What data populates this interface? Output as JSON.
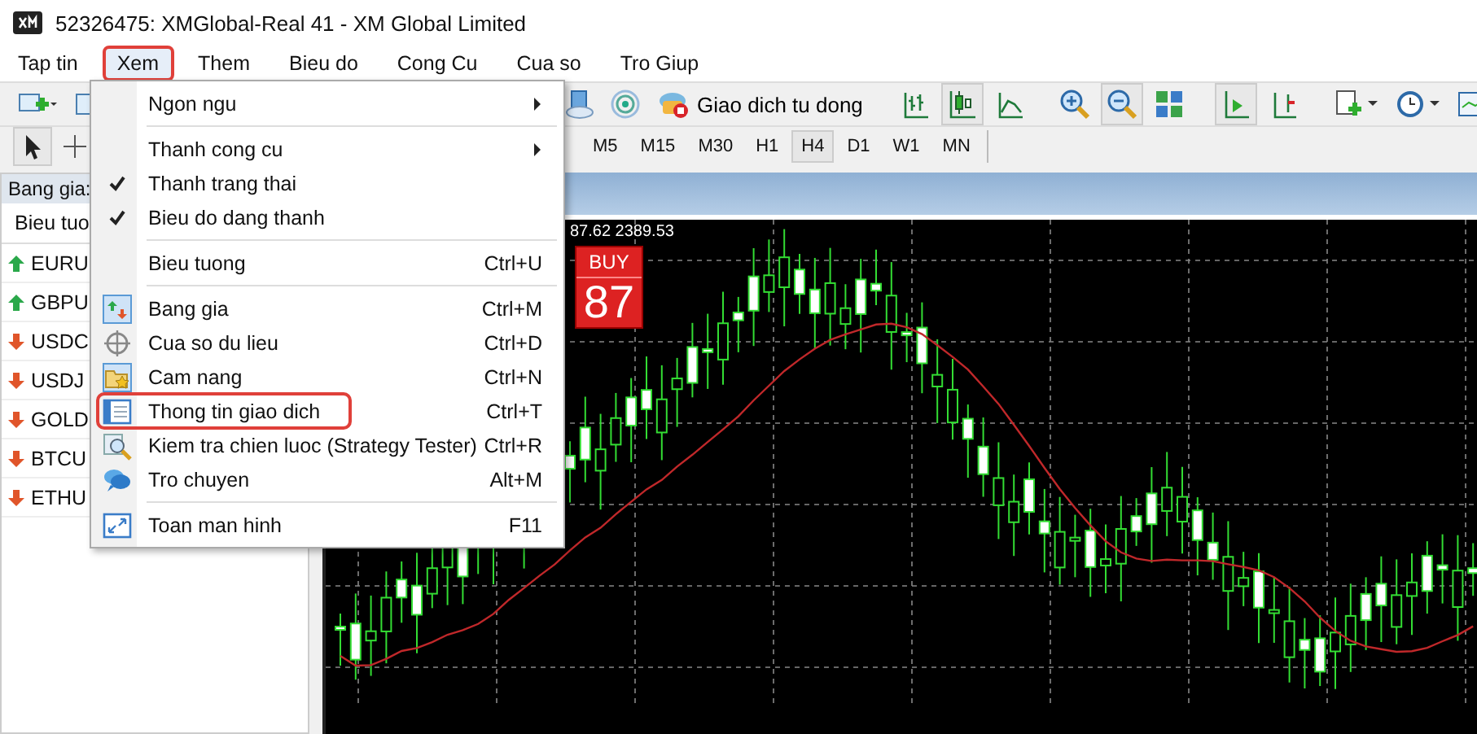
{
  "window": {
    "title": "52326475: XMGlobal-Real 41 - XM Global Limited"
  },
  "menu_bar": [
    {
      "label": "Tap tin",
      "highlighted": false
    },
    {
      "label": "Xem",
      "highlighted": true
    },
    {
      "label": "Them",
      "highlighted": false
    },
    {
      "label": "Bieu do",
      "highlighted": false
    },
    {
      "label": "Cong Cu",
      "highlighted": false
    },
    {
      "label": "Cua so",
      "highlighted": false
    },
    {
      "label": "Tro Giup",
      "highlighted": false
    }
  ],
  "toolbar": {
    "auto_trading_button": "Giao dich tu dong"
  },
  "timeframes": [
    {
      "label": "M5",
      "selected": false
    },
    {
      "label": "M15",
      "selected": false
    },
    {
      "label": "M30",
      "selected": false
    },
    {
      "label": "H1",
      "selected": false
    },
    {
      "label": "H4",
      "selected": true
    },
    {
      "label": "D1",
      "selected": false
    },
    {
      "label": "W1",
      "selected": false
    },
    {
      "label": "MN",
      "selected": false
    }
  ],
  "market_watch": {
    "title": "Bang gia:",
    "column_1": "Bieu tuo",
    "rows": [
      {
        "symbol": "EURU",
        "rising": true
      },
      {
        "symbol": "GBPU",
        "rising": true
      },
      {
        "symbol": "USDC",
        "rising": false
      },
      {
        "symbol": "USDJ",
        "rising": false
      },
      {
        "symbol": "GOLD",
        "rising": false
      },
      {
        "symbol": "BTCU",
        "rising": false
      },
      {
        "symbol": "ETHU",
        "rising": false
      }
    ]
  },
  "chart": {
    "price_info": "87.62 2389.53",
    "buy_label": "BUY",
    "buy_price": "87"
  },
  "view_menu": [
    {
      "kind": "item",
      "label": "Ngon ngu",
      "submenu": true,
      "highlighted": false
    },
    {
      "kind": "separator"
    },
    {
      "kind": "item",
      "label": "Thanh cong cu",
      "submenu": true,
      "highlighted": false
    },
    {
      "kind": "item",
      "label": "Thanh trang thai",
      "checked": true,
      "highlighted": false
    },
    {
      "kind": "item",
      "label": "Bieu do dang thanh",
      "checked": true,
      "highlighted": false
    },
    {
      "kind": "separator"
    },
    {
      "kind": "item",
      "label": "Bieu tuong",
      "shortcut": "Ctrl+U",
      "highlighted": false
    },
    {
      "kind": "separator"
    },
    {
      "kind": "item",
      "label": "Bang gia",
      "shortcut": "Ctrl+M",
      "highlighted": false
    },
    {
      "kind": "item",
      "label": "Cua so du lieu",
      "shortcut": "Ctrl+D",
      "highlighted": false
    },
    {
      "kind": "item",
      "label": "Cam nang",
      "shortcut": "Ctrl+N",
      "highlighted": false
    },
    {
      "kind": "item",
      "label": "Thong tin giao dich",
      "shortcut": "Ctrl+T",
      "highlighted": true
    },
    {
      "kind": "item",
      "label": "Kiem tra chien luoc (Strategy Tester)",
      "shortcut": "Ctrl+R",
      "highlighted": false
    },
    {
      "kind": "item",
      "label": "Tro chuyen",
      "shortcut": "Alt+M",
      "highlighted": false
    },
    {
      "kind": "separator"
    },
    {
      "kind": "item",
      "label": "Toan man hinh",
      "shortcut": "F11",
      "highlighted": false
    }
  ]
}
